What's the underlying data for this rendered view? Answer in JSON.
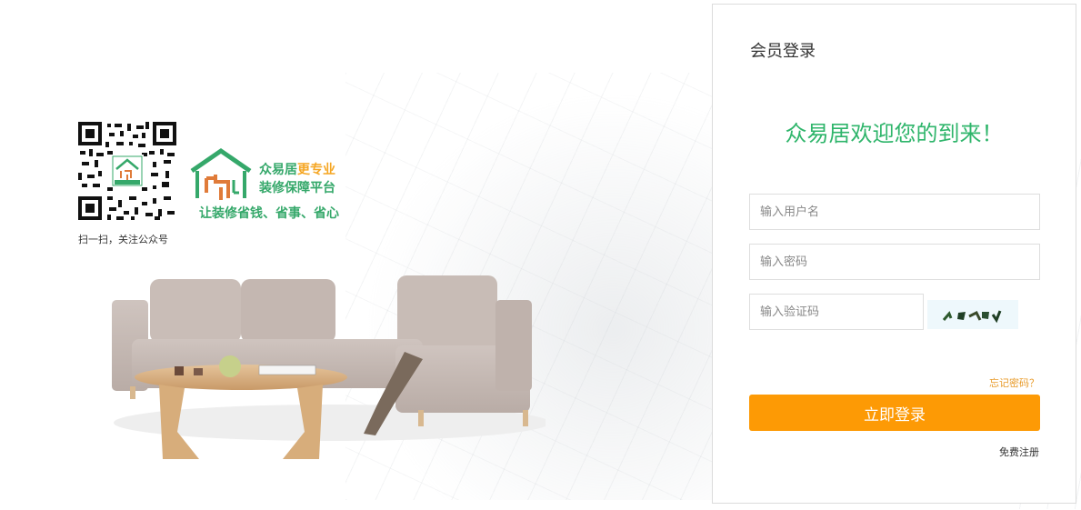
{
  "qr": {
    "caption": "扫一扫，关注公众号"
  },
  "brand": {
    "line1_part1": "众易居",
    "line1_highlight": "更专业",
    "line2": "装修保障平台",
    "slogan": "让装修省钱、省事、省心",
    "color": "#35a86a",
    "highlight_color": "#f5a623"
  },
  "login": {
    "title": "会员登录",
    "welcome": "众易居欢迎您的到来！",
    "username_placeholder": "输入用户名",
    "password_placeholder": "输入密码",
    "captcha_placeholder": "输入验证码",
    "forgot": "忘记密码？",
    "submit": "立即登录",
    "register": "免费注册",
    "accent": "#fd9a05",
    "welcome_color": "#2fb56b"
  }
}
